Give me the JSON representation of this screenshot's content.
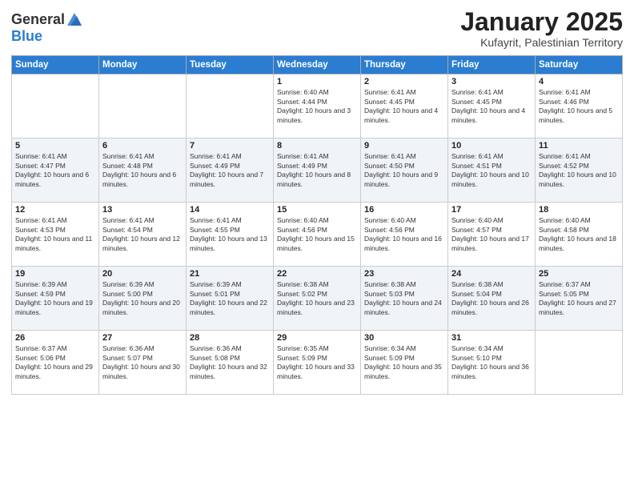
{
  "header": {
    "logo_general": "General",
    "logo_blue": "Blue",
    "month_title": "January 2025",
    "location": "Kufayrit, Palestinian Territory"
  },
  "days_of_week": [
    "Sunday",
    "Monday",
    "Tuesday",
    "Wednesday",
    "Thursday",
    "Friday",
    "Saturday"
  ],
  "weeks": [
    [
      {
        "day": "",
        "info": ""
      },
      {
        "day": "",
        "info": ""
      },
      {
        "day": "",
        "info": ""
      },
      {
        "day": "1",
        "info": "Sunrise: 6:40 AM\nSunset: 4:44 PM\nDaylight: 10 hours and 3 minutes."
      },
      {
        "day": "2",
        "info": "Sunrise: 6:41 AM\nSunset: 4:45 PM\nDaylight: 10 hours and 4 minutes."
      },
      {
        "day": "3",
        "info": "Sunrise: 6:41 AM\nSunset: 4:45 PM\nDaylight: 10 hours and 4 minutes."
      },
      {
        "day": "4",
        "info": "Sunrise: 6:41 AM\nSunset: 4:46 PM\nDaylight: 10 hours and 5 minutes."
      }
    ],
    [
      {
        "day": "5",
        "info": "Sunrise: 6:41 AM\nSunset: 4:47 PM\nDaylight: 10 hours and 6 minutes."
      },
      {
        "day": "6",
        "info": "Sunrise: 6:41 AM\nSunset: 4:48 PM\nDaylight: 10 hours and 6 minutes."
      },
      {
        "day": "7",
        "info": "Sunrise: 6:41 AM\nSunset: 4:49 PM\nDaylight: 10 hours and 7 minutes."
      },
      {
        "day": "8",
        "info": "Sunrise: 6:41 AM\nSunset: 4:49 PM\nDaylight: 10 hours and 8 minutes."
      },
      {
        "day": "9",
        "info": "Sunrise: 6:41 AM\nSunset: 4:50 PM\nDaylight: 10 hours and 9 minutes."
      },
      {
        "day": "10",
        "info": "Sunrise: 6:41 AM\nSunset: 4:51 PM\nDaylight: 10 hours and 10 minutes."
      },
      {
        "day": "11",
        "info": "Sunrise: 6:41 AM\nSunset: 4:52 PM\nDaylight: 10 hours and 10 minutes."
      }
    ],
    [
      {
        "day": "12",
        "info": "Sunrise: 6:41 AM\nSunset: 4:53 PM\nDaylight: 10 hours and 11 minutes."
      },
      {
        "day": "13",
        "info": "Sunrise: 6:41 AM\nSunset: 4:54 PM\nDaylight: 10 hours and 12 minutes."
      },
      {
        "day": "14",
        "info": "Sunrise: 6:41 AM\nSunset: 4:55 PM\nDaylight: 10 hours and 13 minutes."
      },
      {
        "day": "15",
        "info": "Sunrise: 6:40 AM\nSunset: 4:56 PM\nDaylight: 10 hours and 15 minutes."
      },
      {
        "day": "16",
        "info": "Sunrise: 6:40 AM\nSunset: 4:56 PM\nDaylight: 10 hours and 16 minutes."
      },
      {
        "day": "17",
        "info": "Sunrise: 6:40 AM\nSunset: 4:57 PM\nDaylight: 10 hours and 17 minutes."
      },
      {
        "day": "18",
        "info": "Sunrise: 6:40 AM\nSunset: 4:58 PM\nDaylight: 10 hours and 18 minutes."
      }
    ],
    [
      {
        "day": "19",
        "info": "Sunrise: 6:39 AM\nSunset: 4:59 PM\nDaylight: 10 hours and 19 minutes."
      },
      {
        "day": "20",
        "info": "Sunrise: 6:39 AM\nSunset: 5:00 PM\nDaylight: 10 hours and 20 minutes."
      },
      {
        "day": "21",
        "info": "Sunrise: 6:39 AM\nSunset: 5:01 PM\nDaylight: 10 hours and 22 minutes."
      },
      {
        "day": "22",
        "info": "Sunrise: 6:38 AM\nSunset: 5:02 PM\nDaylight: 10 hours and 23 minutes."
      },
      {
        "day": "23",
        "info": "Sunrise: 6:38 AM\nSunset: 5:03 PM\nDaylight: 10 hours and 24 minutes."
      },
      {
        "day": "24",
        "info": "Sunrise: 6:38 AM\nSunset: 5:04 PM\nDaylight: 10 hours and 26 minutes."
      },
      {
        "day": "25",
        "info": "Sunrise: 6:37 AM\nSunset: 5:05 PM\nDaylight: 10 hours and 27 minutes."
      }
    ],
    [
      {
        "day": "26",
        "info": "Sunrise: 6:37 AM\nSunset: 5:06 PM\nDaylight: 10 hours and 29 minutes."
      },
      {
        "day": "27",
        "info": "Sunrise: 6:36 AM\nSunset: 5:07 PM\nDaylight: 10 hours and 30 minutes."
      },
      {
        "day": "28",
        "info": "Sunrise: 6:36 AM\nSunset: 5:08 PM\nDaylight: 10 hours and 32 minutes."
      },
      {
        "day": "29",
        "info": "Sunrise: 6:35 AM\nSunset: 5:09 PM\nDaylight: 10 hours and 33 minutes."
      },
      {
        "day": "30",
        "info": "Sunrise: 6:34 AM\nSunset: 5:09 PM\nDaylight: 10 hours and 35 minutes."
      },
      {
        "day": "31",
        "info": "Sunrise: 6:34 AM\nSunset: 5:10 PM\nDaylight: 10 hours and 36 minutes."
      },
      {
        "day": "",
        "info": ""
      }
    ]
  ]
}
